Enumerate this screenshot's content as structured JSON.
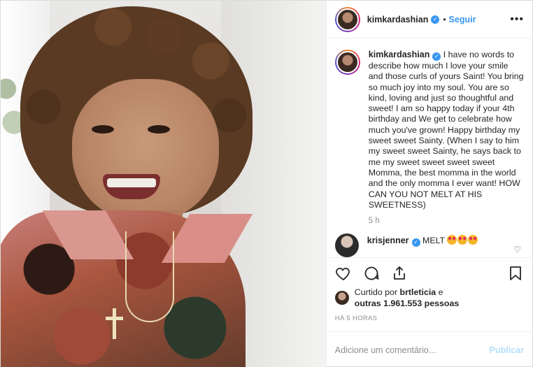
{
  "header": {
    "username": "kimkardashian",
    "follow_label": "Seguir",
    "separator": "•",
    "more": "•••"
  },
  "caption": {
    "username": "kimkardashian",
    "text": "I have no words to describe how much I love your smile and those curls of yours Saint! You bring so much joy into my soul. You are so kind, loving and just so thoughtful and sweet! I am so happy today if your 4th birthday and We get to celebrate how much you've grown! Happy birthday my sweet sweet Sainty. (When I say to him my sweet sweet Sainty, he says back to me my sweet sweet sweet sweet Momma, the best momma in the world and the only momma I ever want! HOW CAN YOU NOT MELT AT HIS SWEETNESS)",
    "time": "5 h"
  },
  "comments": [
    {
      "username": "krisjenner",
      "text": "MELT"
    }
  ],
  "likes": {
    "prefix": "Curtido por",
    "first_user": "brtleticia",
    "and": "e",
    "others": "outras 1.961.553 pessoas"
  },
  "posted_ago": "HÁ 5 HORAS",
  "add_comment": {
    "placeholder": "Adicione um comentário...",
    "publish_label": "Publicar"
  },
  "colors": {
    "link": "#3897f0",
    "publish_disabled": "#b2dffc",
    "verified": "#3897f0"
  },
  "icons": [
    "more-icon",
    "verified-icon",
    "heart-icon",
    "comment-icon",
    "share-icon",
    "bookmark-icon",
    "heart-eyes-emoji"
  ]
}
